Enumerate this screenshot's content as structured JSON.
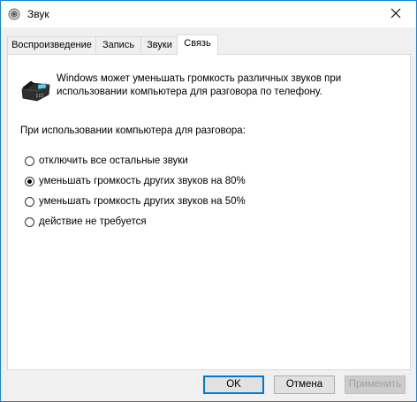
{
  "window": {
    "title": "Звук",
    "title_icon": "speaker-icon",
    "close_icon": "close-icon"
  },
  "tabs": [
    {
      "label": "Воспроизведение",
      "active": false
    },
    {
      "label": "Запись",
      "active": false
    },
    {
      "label": "Звуки",
      "active": false
    },
    {
      "label": "Связь",
      "active": true
    }
  ],
  "communications": {
    "icon": "telephone-icon",
    "description": "Windows может уменьшать громкость различных звуков при использовании компьютера для разговора по телефону.",
    "group_label": "При использовании компьютера для разговора:",
    "options": [
      {
        "label": "отключить все остальные звуки",
        "checked": false
      },
      {
        "label": "уменьшать громкость других звуков на 80%",
        "checked": true
      },
      {
        "label": "уменьшать громкость других звуков на 50%",
        "checked": false
      },
      {
        "label": "действие не требуется",
        "checked": false
      }
    ]
  },
  "buttons": {
    "ok": "OK",
    "cancel": "Отмена",
    "apply": "Применить"
  },
  "colors": {
    "accent": "#0078d7"
  }
}
